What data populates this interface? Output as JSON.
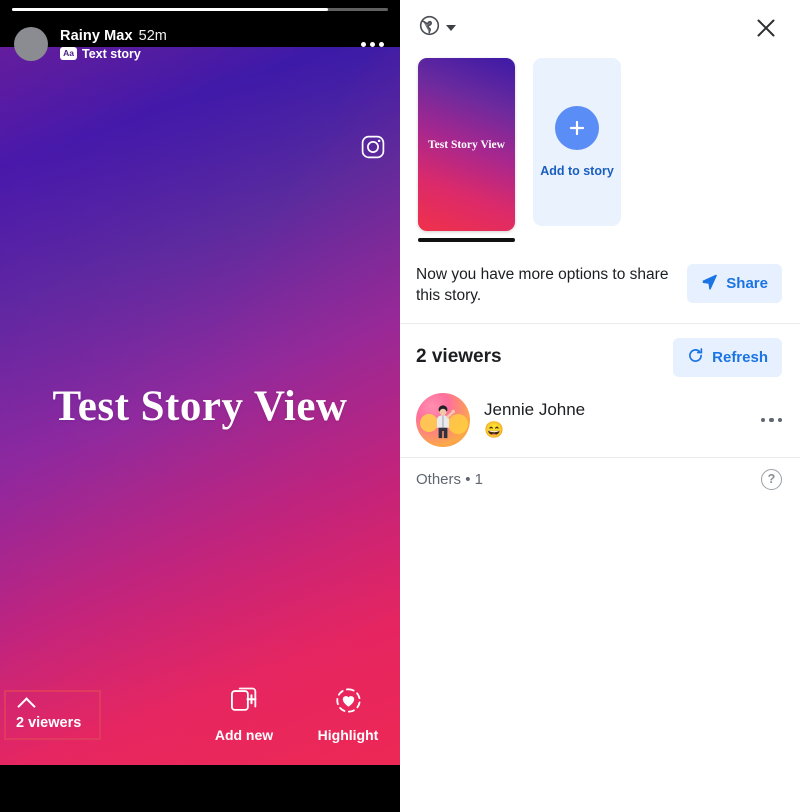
{
  "story": {
    "progress_percent": 84,
    "author_name": "Rainy Max",
    "timestamp": "52m",
    "type_badge": "Aa",
    "type_label": "Text story",
    "body_text": "Test Story View",
    "cross_post_icon": "instagram-icon",
    "more_icon": "more-horizontal-icon",
    "footer": {
      "viewers_label": "2 viewers",
      "chevron_icon": "chevron-up-icon",
      "add_new_label": "Add new",
      "add_new_icon": "add-photo-icon",
      "highlight_label": "Highlight",
      "highlight_icon": "heart-highlight-icon"
    },
    "colors": {
      "gradient_top": "#5b2193",
      "gradient_topright": "#3a1aa8",
      "gradient_bottom": "#e91e63",
      "viewers_outline": "#e03a5f"
    }
  },
  "panel": {
    "privacy_icon": "globe-icon",
    "privacy_caret_icon": "chevron-down-icon",
    "close_icon": "close-icon",
    "story_card": {
      "caption": "Test Story View",
      "active": true
    },
    "add_to_story": {
      "label": "Add to story",
      "icon": "plus-icon"
    },
    "share": {
      "message": "Now you have more options to share this story.",
      "button_label": "Share",
      "button_icon": "share-arrow-icon"
    },
    "viewers": {
      "title": "2 viewers",
      "refresh_label": "Refresh",
      "refresh_icon": "refresh-icon",
      "list": [
        {
          "name": "Jennie Johne",
          "reaction": "😄",
          "menu_icon": "more-horizontal-icon"
        }
      ],
      "others_label": "Others",
      "others_separator": "•",
      "others_count": "1",
      "help_icon": "help-circle-icon",
      "help_glyph": "?"
    },
    "colors": {
      "accent_blue": "#1b74e4",
      "soft_blue_bg": "#e7f0fe",
      "add_card_bg": "#eaf2fe",
      "plus_circle": "#5a8df5"
    }
  }
}
